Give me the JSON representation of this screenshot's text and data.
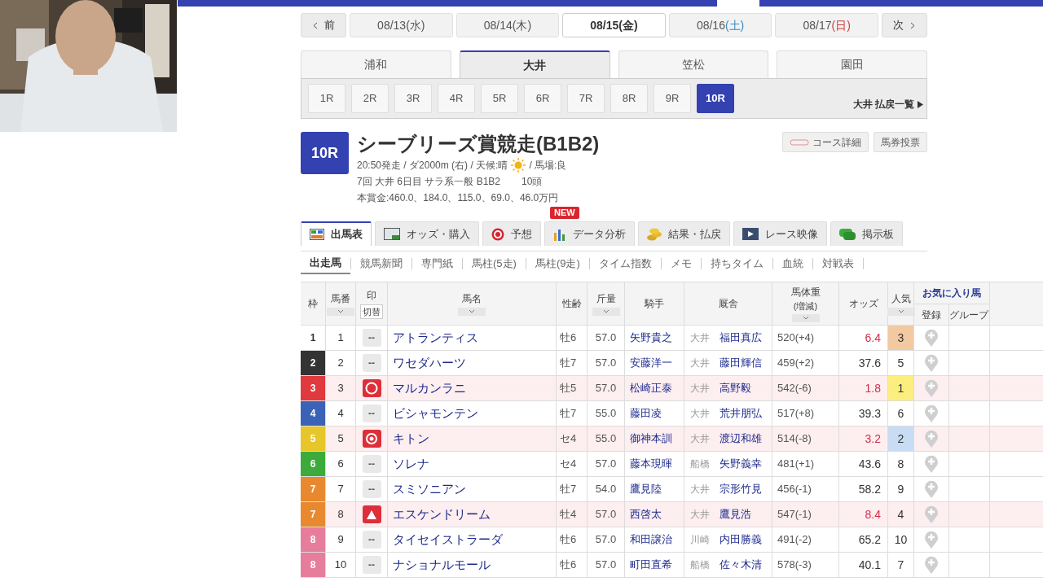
{
  "date_nav": {
    "prev": "前",
    "next": "次",
    "dates": [
      {
        "date": "08/13",
        "day": "(水)",
        "kind": "weekday",
        "selected": false
      },
      {
        "date": "08/14",
        "day": "(木)",
        "kind": "weekday",
        "selected": false
      },
      {
        "date": "08/15",
        "day": "(金)",
        "kind": "weekday",
        "selected": true
      },
      {
        "date": "08/16",
        "day": "(土)",
        "kind": "saturday",
        "selected": false
      },
      {
        "date": "08/17",
        "day": "(日)",
        "kind": "sunday",
        "selected": false
      }
    ]
  },
  "venues": [
    {
      "label": "浦和",
      "selected": false
    },
    {
      "label": "大井",
      "selected": true
    },
    {
      "label": "笠松",
      "selected": false
    },
    {
      "label": "園田",
      "selected": false
    }
  ],
  "races": [
    {
      "label": "1R",
      "selected": false
    },
    {
      "label": "2R",
      "selected": false
    },
    {
      "label": "3R",
      "selected": false
    },
    {
      "label": "4R",
      "selected": false
    },
    {
      "label": "5R",
      "selected": false
    },
    {
      "label": "6R",
      "selected": false
    },
    {
      "label": "7R",
      "selected": false
    },
    {
      "label": "8R",
      "selected": false
    },
    {
      "label": "9R",
      "selected": false
    },
    {
      "label": "10R",
      "selected": true
    }
  ],
  "payout_link": "大井 払戻一覧",
  "race": {
    "number": "10R",
    "title": "シーブリーズ賞競走(B1B2)",
    "info_before_weather": "20:50発走 / ダ2000m (右) / 天候:晴",
    "info_after_weather": "/ 馬場:良",
    "meta": "7回 大井 6日目 サラ系一般 B1B2",
    "runners": "10頭",
    "prize": "本賞金:460.0、184.0、115.0、69.0、46.0万円",
    "buttons": [
      {
        "label": "コース詳細",
        "kind": "course"
      },
      {
        "label": "馬券投票",
        "kind": "plain"
      }
    ]
  },
  "main_tabs": [
    {
      "label": "出馬表",
      "kind": "table",
      "selected": true
    },
    {
      "label": "オッズ・購入",
      "kind": "odds",
      "selected": false
    },
    {
      "label": "予想",
      "kind": "target",
      "selected": false
    },
    {
      "label": "データ分析",
      "kind": "chart",
      "selected": false,
      "badge": "NEW"
    },
    {
      "label": "結果・払戻",
      "kind": "coins",
      "selected": false
    },
    {
      "label": "レース映像",
      "kind": "video",
      "selected": false
    },
    {
      "label": "掲示板",
      "kind": "chat",
      "selected": false
    }
  ],
  "sub_tabs": [
    {
      "label": "出走馬",
      "selected": true
    },
    {
      "label": "競馬新聞",
      "selected": false
    },
    {
      "label": "専門紙",
      "selected": false
    },
    {
      "label": "馬柱(5走)",
      "selected": false
    },
    {
      "label": "馬柱(9走)",
      "selected": false
    },
    {
      "label": "タイム指数",
      "selected": false
    },
    {
      "label": "メモ",
      "selected": false
    },
    {
      "label": "持ちタイム",
      "selected": false
    },
    {
      "label": "血統",
      "selected": false
    },
    {
      "label": "対戦表",
      "selected": false
    }
  ],
  "table": {
    "columns": [
      {
        "label": "枠",
        "sortable": false
      },
      {
        "label": "馬番",
        "sortable": true
      },
      {
        "label": "印",
        "sortable": false,
        "toggle": "切替"
      },
      {
        "label": "馬名",
        "sortable": true
      },
      {
        "label": "性齢",
        "sortable": false
      },
      {
        "label": "斤量",
        "sortable": true
      },
      {
        "label": "騎手",
        "sortable": false
      },
      {
        "label": "厩舎",
        "sortable": false
      },
      {
        "label": "馬体重",
        "sortable": true,
        "sub": "(増減)"
      },
      {
        "label": "オッズ",
        "sortable": false
      },
      {
        "label": "人気",
        "sortable": true
      }
    ],
    "favorites": {
      "label": "お気に入り馬",
      "columns": [
        "登録",
        "グループ"
      ]
    },
    "rows": [
      {
        "waku": {
          "number": "1",
          "color": "#ffffff"
        },
        "umaban": "1",
        "mark": {
          "kind": "none",
          "text": "--"
        },
        "name": "アトランティス",
        "sex_age": "牡6",
        "weight": "57.0",
        "jockey": "矢野貴之",
        "region": "大井",
        "trainer": "福田真広",
        "body_weight": "520(+4)",
        "odds": "6.4",
        "odds_hot": true,
        "popularity": {
          "text": "3",
          "color": "#f3c9a2"
        },
        "highlighted": false
      },
      {
        "waku": {
          "number": "2",
          "color": "#333333"
        },
        "umaban": "2",
        "mark": {
          "kind": "none",
          "text": "--"
        },
        "name": "ワセダハーツ",
        "sex_age": "牡7",
        "weight": "57.0",
        "jockey": "安藤洋一",
        "region": "大井",
        "trainer": "藤田輝信",
        "body_weight": "459(+2)",
        "odds": "37.6",
        "odds_hot": false,
        "popularity": {
          "text": "5"
        },
        "highlighted": false
      },
      {
        "waku": {
          "number": "3",
          "color": "#e0393e"
        },
        "umaban": "3",
        "mark": {
          "kind": "circle"
        },
        "name": "マルカンラニ",
        "sex_age": "牡5",
        "weight": "57.0",
        "jockey": "松崎正泰",
        "region": "大井",
        "trainer": "高野毅",
        "body_weight": "542(-6)",
        "odds": "1.8",
        "odds_hot": true,
        "popularity": {
          "text": "1",
          "color": "#fbee7e"
        },
        "highlighted": true
      },
      {
        "waku": {
          "number": "4",
          "color": "#3a63b8"
        },
        "umaban": "4",
        "mark": {
          "kind": "none",
          "text": "--"
        },
        "name": "ビシャモンテン",
        "sex_age": "牡7",
        "weight": "55.0",
        "jockey": "藤田凌",
        "region": "大井",
        "trainer": "荒井朋弘",
        "body_weight": "517(+8)",
        "odds": "39.3",
        "odds_hot": false,
        "popularity": {
          "text": "6"
        },
        "highlighted": false
      },
      {
        "waku": {
          "number": "5",
          "color": "#e6c62a"
        },
        "umaban": "5",
        "mark": {
          "kind": "double_circle"
        },
        "name": "キトン",
        "sex_age": "セ4",
        "weight": "55.0",
        "jockey": "御神本訓",
        "region": "大井",
        "trainer": "渡辺和雄",
        "body_weight": "514(-8)",
        "odds": "3.2",
        "odds_hot": true,
        "popularity": {
          "text": "2",
          "color": "#c8dcf4"
        },
        "highlighted": true
      },
      {
        "waku": {
          "number": "6",
          "color": "#3cab3c"
        },
        "umaban": "6",
        "mark": {
          "kind": "none",
          "text": "--"
        },
        "name": "ソレナ",
        "sex_age": "セ4",
        "weight": "57.0",
        "jockey": "藤本現暉",
        "region": "船橋",
        "trainer": "矢野義幸",
        "body_weight": "481(+1)",
        "odds": "43.6",
        "odds_hot": false,
        "popularity": {
          "text": "8"
        },
        "highlighted": false
      },
      {
        "waku": {
          "number": "7",
          "color": "#e8892f"
        },
        "umaban": "7",
        "mark": {
          "kind": "none",
          "text": "--"
        },
        "name": "スミソニアン",
        "sex_age": "牡7",
        "weight": "54.0",
        "jockey": "鷹見陸",
        "region": "大井",
        "trainer": "宗形竹見",
        "body_weight": "456(-1)",
        "odds": "58.2",
        "odds_hot": false,
        "popularity": {
          "text": "9"
        },
        "highlighted": false
      },
      {
        "waku": {
          "number": "7",
          "color": "#e8892f"
        },
        "umaban": "8",
        "mark": {
          "kind": "triangle"
        },
        "name": "エスケンドリーム",
        "sex_age": "牡4",
        "weight": "57.0",
        "jockey": "西啓太",
        "region": "大井",
        "trainer": "鷹見浩",
        "body_weight": "547(-1)",
        "odds": "8.4",
        "odds_hot": true,
        "popularity": {
          "text": "4"
        },
        "highlighted": true
      },
      {
        "waku": {
          "number": "8",
          "color": "#e77d9c"
        },
        "umaban": "9",
        "mark": {
          "kind": "none",
          "text": "--"
        },
        "name": "タイセイストラーダ",
        "sex_age": "牡6",
        "weight": "57.0",
        "jockey": "和田譲治",
        "region": "川崎",
        "trainer": "内田勝義",
        "body_weight": "491(-2)",
        "odds": "65.2",
        "odds_hot": false,
        "popularity": {
          "text": "10"
        },
        "highlighted": false
      },
      {
        "waku": {
          "number": "8",
          "color": "#e77d9c"
        },
        "umaban": "10",
        "mark": {
          "kind": "none",
          "text": "--"
        },
        "name": "ナショナルモール",
        "sex_age": "牡6",
        "weight": "57.0",
        "jockey": "町田直希",
        "region": "船橋",
        "trainer": "佐々木清",
        "body_weight": "578(-3)",
        "odds": "40.1",
        "odds_hot": false,
        "popularity": {
          "text": "7"
        },
        "highlighted": false
      }
    ]
  }
}
